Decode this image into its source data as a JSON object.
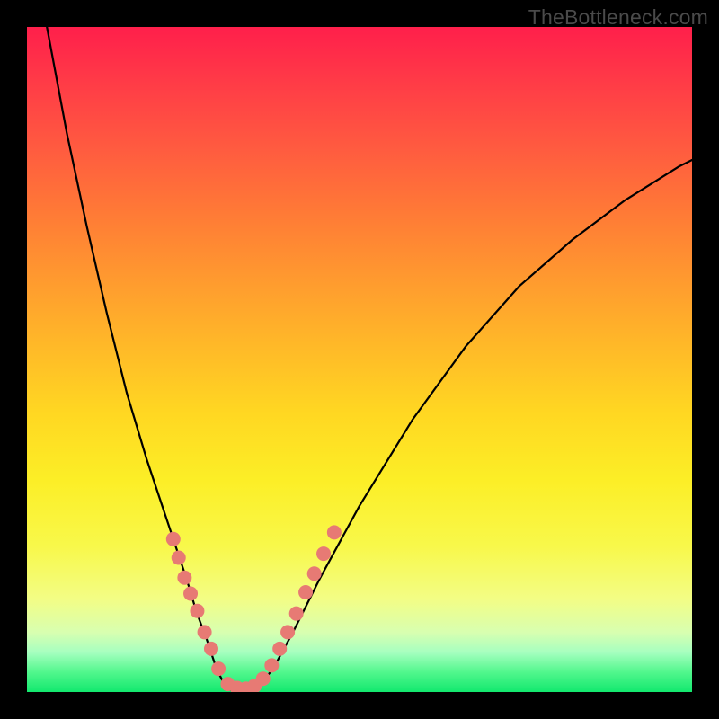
{
  "watermark": {
    "text": "TheBottleneck.com"
  },
  "chart_data": {
    "type": "line",
    "title": "",
    "xlabel": "",
    "ylabel": "",
    "xlim": [
      0,
      100
    ],
    "ylim": [
      0,
      100
    ],
    "axes_visible": false,
    "grid": false,
    "background": "rainbow-vertical-gradient",
    "series": [
      {
        "name": "left-branch",
        "x": [
          3,
          6,
          9,
          12,
          15,
          18,
          20,
          22,
          24,
          25.5,
          27,
          28.5,
          30
        ],
        "y": [
          100,
          84,
          70,
          57,
          45,
          35,
          29,
          23,
          17,
          12,
          8,
          3.5,
          0.5
        ]
      },
      {
        "name": "valley",
        "x": [
          30,
          31,
          32,
          33,
          34,
          35
        ],
        "y": [
          0.5,
          0.2,
          0.1,
          0.1,
          0.3,
          1.0
        ]
      },
      {
        "name": "right-branch",
        "x": [
          35,
          37,
          40,
          44,
          50,
          58,
          66,
          74,
          82,
          90,
          98,
          100
        ],
        "y": [
          1.0,
          3.5,
          9,
          17,
          28,
          41,
          52,
          61,
          68,
          74,
          79,
          80
        ]
      }
    ],
    "markers": [
      {
        "x": 22.0,
        "y": 23.0
      },
      {
        "x": 22.8,
        "y": 20.2
      },
      {
        "x": 23.7,
        "y": 17.2
      },
      {
        "x": 24.6,
        "y": 14.8
      },
      {
        "x": 25.6,
        "y": 12.2
      },
      {
        "x": 26.7,
        "y": 9.0
      },
      {
        "x": 27.7,
        "y": 6.5
      },
      {
        "x": 28.8,
        "y": 3.5
      },
      {
        "x": 30.2,
        "y": 1.2
      },
      {
        "x": 31.6,
        "y": 0.6
      },
      {
        "x": 32.9,
        "y": 0.5
      },
      {
        "x": 34.2,
        "y": 0.9
      },
      {
        "x": 35.5,
        "y": 2.0
      },
      {
        "x": 36.8,
        "y": 4.0
      },
      {
        "x": 38.0,
        "y": 6.5
      },
      {
        "x": 39.2,
        "y": 9.0
      },
      {
        "x": 40.5,
        "y": 11.8
      },
      {
        "x": 41.9,
        "y": 15.0
      },
      {
        "x": 43.2,
        "y": 17.8
      },
      {
        "x": 44.6,
        "y": 20.8
      },
      {
        "x": 46.2,
        "y": 24.0
      }
    ],
    "marker_radius": 8
  }
}
